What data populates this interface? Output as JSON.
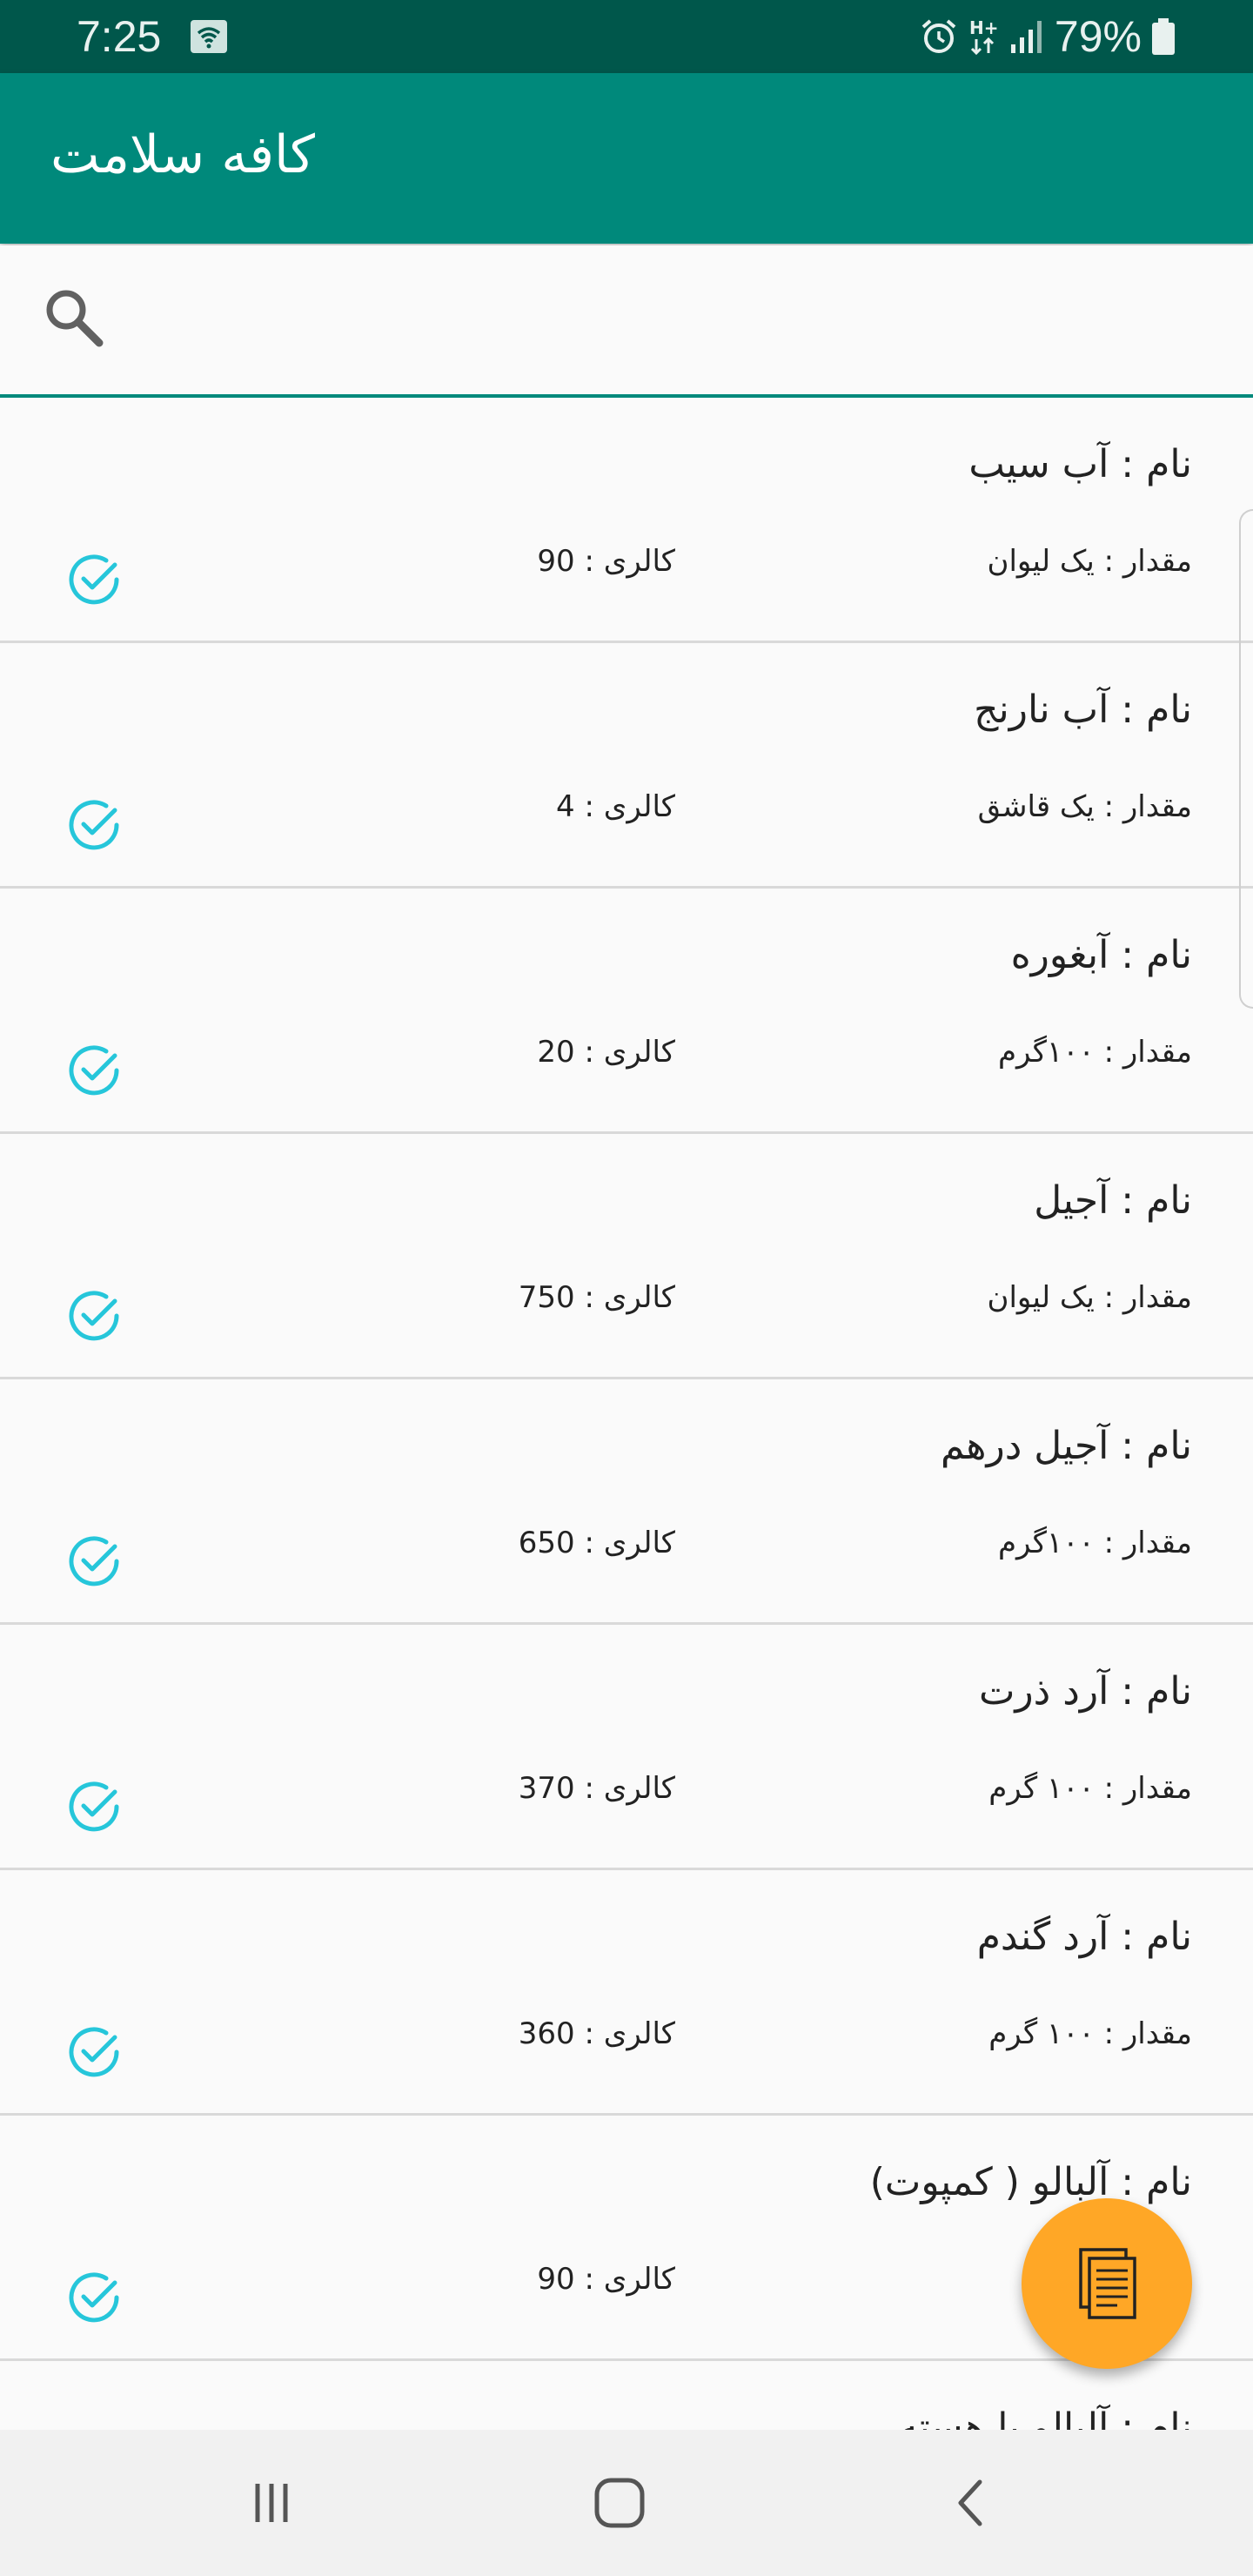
{
  "status_bar": {
    "time": "7:25",
    "battery": "79%",
    "icons": [
      "wifi-hotspot-icon",
      "alarm-icon",
      "hplus-data-icon",
      "signal-icon",
      "battery-icon"
    ]
  },
  "app_bar": {
    "title": "کافه سلامت"
  },
  "search": {
    "placeholder": "",
    "value": ""
  },
  "colors": {
    "primary": "#00897b",
    "primary_dark": "#00574b",
    "accent": "#ffa726",
    "check": "#26c6da"
  },
  "items": [
    {
      "name": "نام : آب سیب",
      "amount": "مقدار : یک لیوان",
      "calorie": "کالری : 90"
    },
    {
      "name": "نام : آب نارنج",
      "amount": "مقدار : یک قاشق",
      "calorie": "کالری : 4"
    },
    {
      "name": "نام : آبغوره",
      "amount": "مقدار : ۱۰۰گرم",
      "calorie": "کالری : 20"
    },
    {
      "name": "نام : آجیل",
      "amount": "مقدار : یک لیوان",
      "calorie": "کالری : 750"
    },
    {
      "name": "نام : آجیل درهم",
      "amount": "مقدار : ۱۰۰گرم",
      "calorie": "کالری : 650"
    },
    {
      "name": "نام : آرد ذرت",
      "amount": "مقدار : ۱۰۰ گرم",
      "calorie": "کالری : 370"
    },
    {
      "name": "نام : آرد گندم",
      "amount": "مقدار : ۱۰۰ گرم",
      "calorie": "کالری : 360"
    },
    {
      "name": "نام : آلبالو ( کمپوت)",
      "amount": "",
      "calorie": "کالری : 90"
    }
  ],
  "partial_item": {
    "name": "نام : آلبالو یا هسته"
  },
  "fab": {
    "icon": "document-icon"
  },
  "nav": {
    "recents_icon": "recents-icon",
    "home_icon": "home-icon",
    "back_icon": "back-icon"
  }
}
